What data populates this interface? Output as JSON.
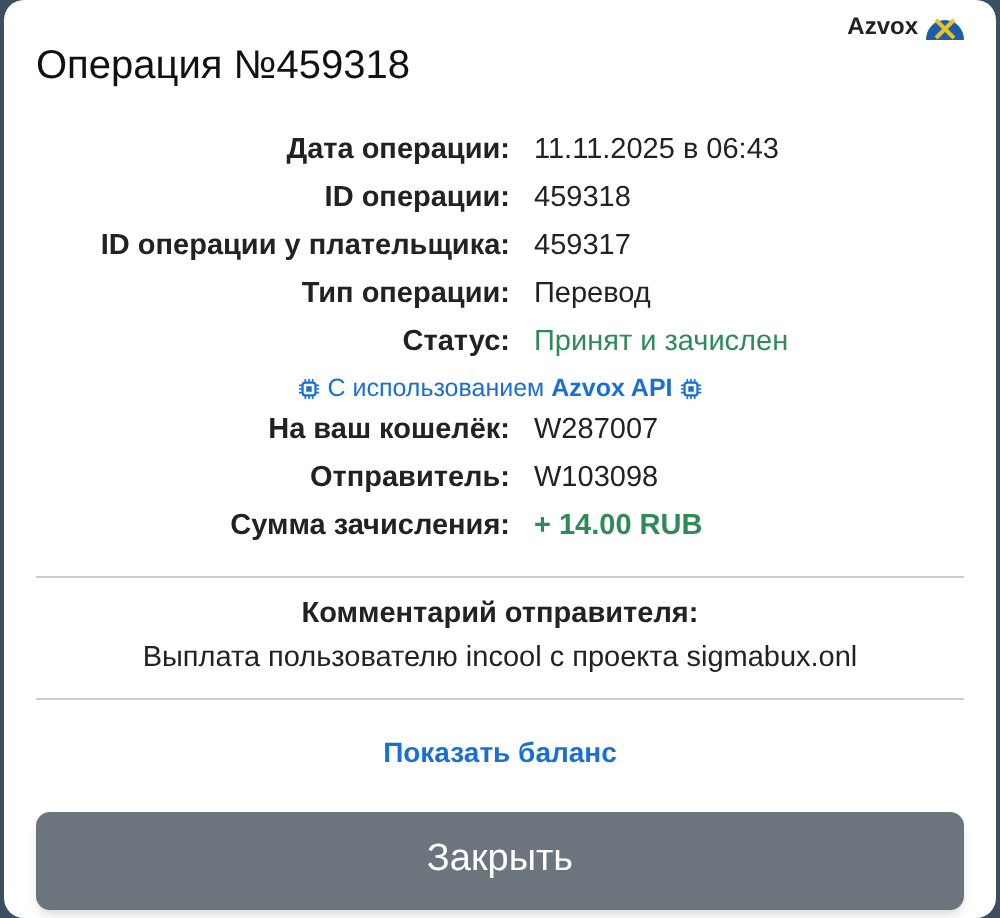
{
  "brand": "Azvox",
  "title": "Операция №459318",
  "details": [
    {
      "label": "Дата операции:",
      "value": "11.11.2025 в 06:43",
      "kind": "plain"
    },
    {
      "label": "ID операции:",
      "value": "459318",
      "kind": "plain"
    },
    {
      "label": "ID операции у плательщика:",
      "value": "459317",
      "kind": "plain"
    },
    {
      "label": "Тип операции:",
      "value": "Перевод",
      "kind": "plain"
    },
    {
      "label": "Статус:",
      "value": "Принят и зачислен",
      "kind": "success"
    }
  ],
  "api_note": "С использованием **Azvox API**",
  "details_2": [
    {
      "label": "На ваш кошелёк:",
      "value": "W287007",
      "kind": "plain"
    },
    {
      "label": "Отправитель:",
      "value": "W103098",
      "kind": "plain"
    },
    {
      "label": "Сумма зачисления:",
      "value": "+ 14.00 RUB",
      "kind": "amount"
    }
  ],
  "comment": {
    "heading": "Комментарий отправителя:",
    "text": "Выплата пользователю incool с проекта sigmabux.onl"
  },
  "balance_link": "Показать баланс",
  "close_button": "Закрыть"
}
